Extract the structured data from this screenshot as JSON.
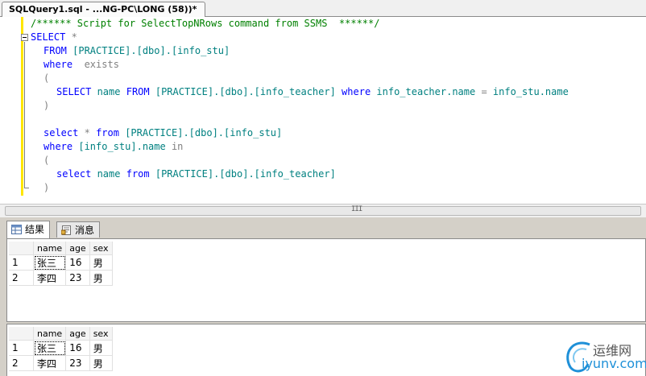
{
  "document_tab": {
    "title": "SQLQuery1.sql - ...NG-PC\\LONG (58))*"
  },
  "editor": {
    "lines": [
      {
        "text": "/****** Script for SelectTopNRows command from SSMS  ******/"
      },
      {
        "parts": [
          "SELECT",
          " *"
        ]
      },
      {
        "parts": [
          "FROM",
          " [PRACTICE].[dbo].[info_stu]"
        ]
      },
      {
        "parts": [
          "where",
          "  exists"
        ]
      },
      {
        "text": "("
      },
      {
        "parts": [
          "SELECT",
          " name ",
          "FROM",
          " [PRACTICE].[dbo].[info_teacher] ",
          "where",
          " info_teacher.name ",
          "=",
          " info_stu.name"
        ]
      },
      {
        "text": ")"
      },
      {
        "parts": [
          "select",
          " ",
          "*",
          " ",
          "from",
          " [PRACTICE].[dbo].[info_stu]"
        ]
      },
      {
        "parts": [
          "where",
          " [info_stu].name ",
          "in"
        ]
      },
      {
        "text": "("
      },
      {
        "parts": [
          "select",
          " name ",
          "from",
          " [PRACTICE].[dbo].[info_teacher]"
        ]
      },
      {
        "text": ")"
      }
    ]
  },
  "scrollbar": {
    "grip": "III"
  },
  "results_tabs": [
    {
      "label": "结果",
      "icon": "grid-icon"
    },
    {
      "label": "消息",
      "icon": "message-icon"
    }
  ],
  "result_sets": [
    {
      "columns": [
        "name",
        "age",
        "sex"
      ],
      "rows": [
        {
          "num": "1",
          "cells": [
            "张三",
            "16",
            "男"
          ]
        },
        {
          "num": "2",
          "cells": [
            "李四",
            "23",
            "男"
          ]
        }
      ]
    },
    {
      "columns": [
        "name",
        "age",
        "sex"
      ],
      "rows": [
        {
          "num": "1",
          "cells": [
            "张三",
            "16",
            "男"
          ]
        },
        {
          "num": "2",
          "cells": [
            "李四",
            "23",
            "男"
          ]
        }
      ]
    }
  ],
  "watermark": {
    "cn": "运维网",
    "en": "iyunv.com"
  },
  "colors": {
    "keyword": "#0000ff",
    "comment": "#008000",
    "gray_operator": "#808080",
    "teal_identifier": "#008080",
    "margin_marker": "#ffe600",
    "watermark_blue": "#1e90d8"
  }
}
